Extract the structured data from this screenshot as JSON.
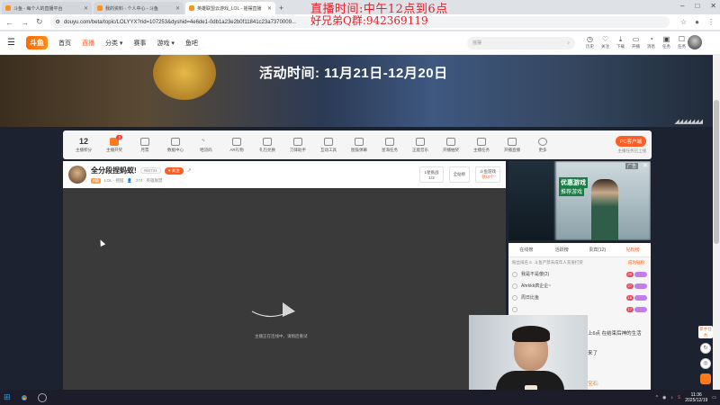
{
  "browser": {
    "tabs": [
      {
        "title": "斗鱼 - 每个人的直播平台",
        "active": false
      },
      {
        "title": "我的资料 - 个人中心 - 斗鱼",
        "active": false
      },
      {
        "title": "英雄联盟云游戏_LOL - 摇摆直播",
        "active": true
      }
    ],
    "url": "douyu.com/beta/topic/LOLYYX?rid=107253&dyshid=4e6de1-0db1a23e2b0f11841c23a7370009..."
  },
  "overlay": {
    "line1": "直播时间:中午12点到6点",
    "line2": "好兄弟Q群:942369119"
  },
  "site": {
    "logo": "斗鱼",
    "nav": [
      "首页",
      "直播",
      "分类",
      "赛事",
      "游戏",
      "鱼吧"
    ],
    "active_nav": "直播",
    "search_placeholder": "摇摆",
    "header_icons": [
      "历史",
      "关注",
      "下载",
      "开播",
      "消息",
      "任务",
      "任务"
    ]
  },
  "banner": {
    "title": "活动时间: 11月21日-12月20日"
  },
  "funcbar": {
    "level": "12",
    "level_label": "主播积分",
    "items": [
      "主播开奖",
      "月票",
      "数据中心",
      "晒流码",
      "AR礼物",
      "礼包兑换",
      "刀锋助手",
      "互动工具",
      "图鼓弹幕",
      "星海任务",
      "正能音乐",
      "开播抽奖",
      "主播任务",
      "开播直播",
      "更多"
    ],
    "badge": "2",
    "pc_button": "PC客户端",
    "pc_sub": "主播任务已上线"
  },
  "room": {
    "title": "全分段捏蚂蚁!",
    "room_id": "#60734",
    "follow": "关注",
    "level_tag": "3级",
    "category": "LOL - 摇摆",
    "viewers": "274",
    "game": "英雄联盟",
    "box1_label": "1星挑战",
    "box1_value": "1/3",
    "box2_label": "全站榜",
    "box3_label": "斗鱼游戏",
    "box3_value": "领10个"
  },
  "video": {
    "message": "主播正在连线中，请稍后重试"
  },
  "ad": {
    "label": "广告",
    "headline": "优惠游戏",
    "subline": "推荐游戏"
  },
  "chat": {
    "tabs": [
      "在线榜",
      "活跃榜",
      "贵宾(12)",
      "钻粉榜"
    ],
    "active_tab": "钻粉榜",
    "rank_label": "粉丝排名 5",
    "rank_text": "斗鱼严禁未成年人充值打赏",
    "rank_btn": "成为钻粉",
    "rows": [
      {
        "name": "我是不是傻(2)",
        "lv": "20"
      },
      {
        "name": "Ahrkkk疯企企~",
        "lv": "27"
      },
      {
        "name": "周日比鱼",
        "lv": "18"
      },
      {
        "name": "",
        "lv": "17"
      }
    ],
    "text1": "上6点 在结束后神的生活",
    "text2": "来了",
    "text3": "宝石:"
  },
  "floatbar": {
    "label": "新手任务"
  },
  "taskbar": {
    "time": "11:36",
    "date": "2025/12/19"
  }
}
